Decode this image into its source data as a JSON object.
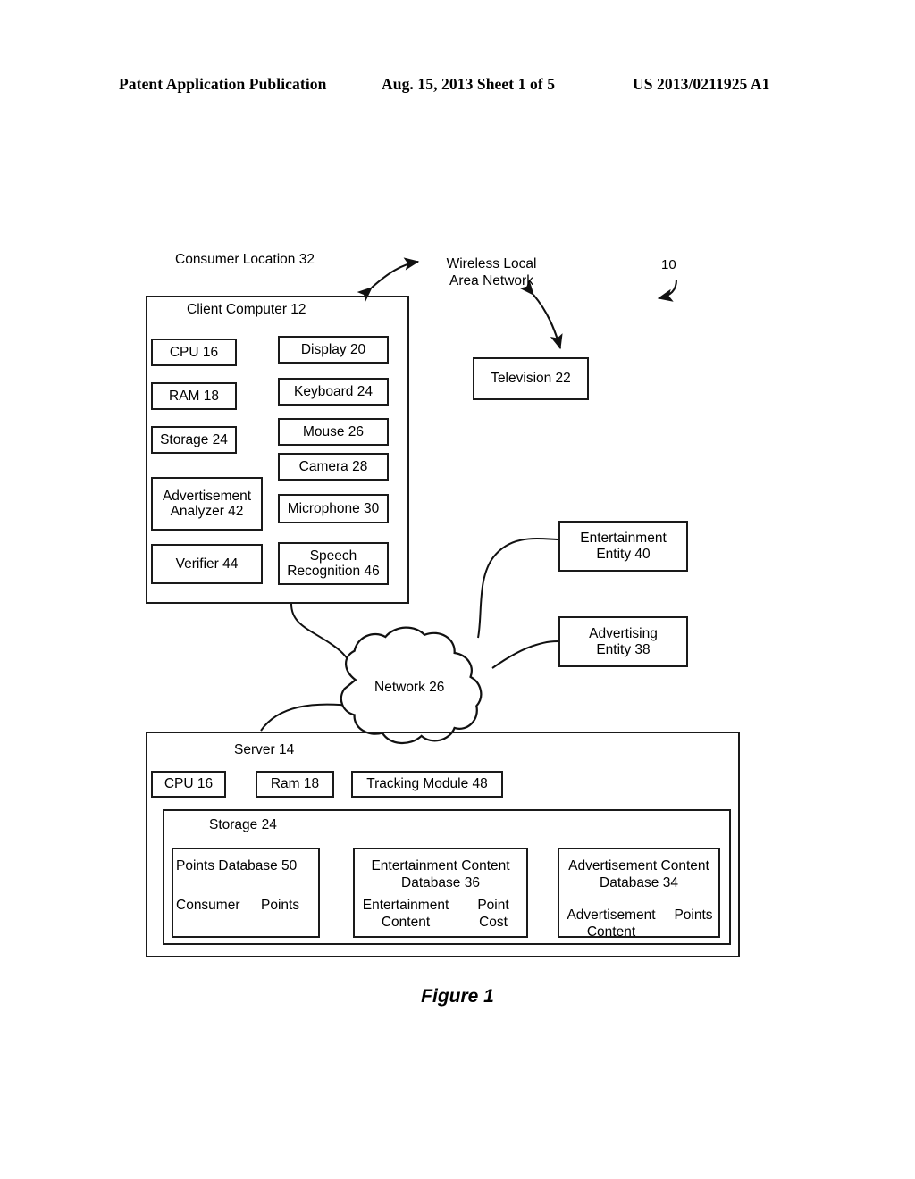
{
  "header": {
    "left": "Patent Application Publication",
    "middle": "Aug. 15, 2013  Sheet 1 of 5",
    "right": "US 2013/0211925 A1"
  },
  "figure": {
    "caption": "Figure 1",
    "reference_numeral": "10"
  },
  "diagram": {
    "consumer_location_label": "Consumer Location 32",
    "wlan_label": "Wireless Local\nArea Network",
    "client_computer_label": "Client Computer 12",
    "television": "Television 22",
    "network_cloud": "Network 26",
    "client_left_column": [
      {
        "label": "CPU 16"
      },
      {
        "label": "RAM 18"
      },
      {
        "label": "Storage 24"
      },
      {
        "label": "Advertisement\nAnalyzer 42"
      },
      {
        "label": "Verifier 44"
      }
    ],
    "client_right_column": [
      {
        "label": "Display 20"
      },
      {
        "label": "Keyboard 24"
      },
      {
        "label": "Mouse 26"
      },
      {
        "label": "Camera 28"
      },
      {
        "label": "Microphone 30"
      },
      {
        "label": "Speech\nRecognition 46"
      }
    ],
    "entities": [
      {
        "label": "Entertainment\nEntity 40"
      },
      {
        "label": "Advertising\nEntity 38"
      }
    ],
    "server": {
      "title": "Server 14",
      "modules": [
        {
          "label": "CPU 16"
        },
        {
          "label": "Ram 18"
        },
        {
          "label": "Tracking Module 48"
        }
      ],
      "storage_title": "Storage 24",
      "databases": [
        {
          "title": "Points Database 50",
          "col_left": "Consumer",
          "col_right": "Points"
        },
        {
          "title": "Entertainment Content\nDatabase 36",
          "col_left": "Entertainment\nContent",
          "col_right": "Point\nCost"
        },
        {
          "title": "Advertisement Content\nDatabase 34",
          "col_left": "Advertisement\nContent",
          "col_right": "Points"
        }
      ]
    }
  },
  "colors": {
    "ink": "#1a1a1a",
    "paper": "#ffffff"
  }
}
